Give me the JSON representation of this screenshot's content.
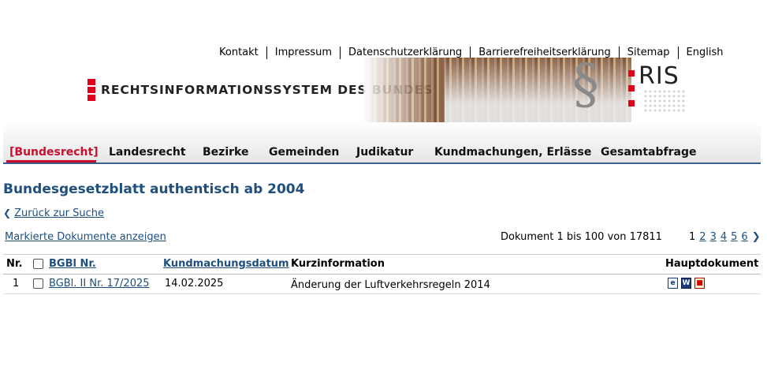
{
  "toplinks": [
    "Kontakt",
    "Impressum",
    "Datenschutzerklärung",
    "Barrierefreiheitserklärung",
    "Sitemap",
    "English"
  ],
  "brand": {
    "title": "RECHTSINFORMATIONSSYSTEM DES BUNDES",
    "logo_text": "RIS",
    "section_symbol": "§",
    "accent": "#e1011a"
  },
  "nav": [
    "[Bundesrecht]",
    "Landesrecht",
    "Bezirke",
    "Gemeinden",
    "Judikatur",
    "Kundmachungen, Erlässe",
    "Gesamtabfrage"
  ],
  "page": {
    "title": "Bundesgesetzblatt authentisch ab 2004",
    "back_label": "Zurück zur Suche",
    "marked_label": "Markierte Dokumente anzeigen",
    "doc_count": "Dokument 1 bis 100 von 17811"
  },
  "pager": {
    "current": "1",
    "pages": [
      "2",
      "3",
      "4",
      "5",
      "6"
    ]
  },
  "table": {
    "headers": {
      "nr": "Nr.",
      "bgbl": "BGBl Nr.",
      "date": "Kundmachungsdatum",
      "info": "Kurzinformation",
      "main": "Hauptdokument"
    },
    "rows": [
      {
        "nr": "1",
        "bgbl": "BGBl. II Nr. 17/2025",
        "date": "14.02.2025",
        "info": "Änderung der Luftverkehrsregeln 2014",
        "icons": [
          "html-icon",
          "word-icon",
          "pdf-icon"
        ]
      }
    ]
  },
  "colors": {
    "link": "#1f4f7f",
    "active_nav": "#c8102e",
    "nav_rule": "#3a5f8a"
  }
}
